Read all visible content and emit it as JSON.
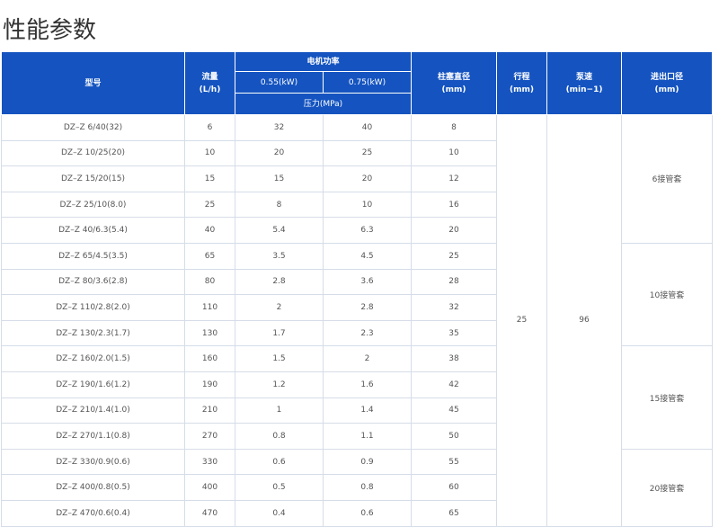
{
  "title": "性能参数",
  "header": {
    "model": "型号",
    "flow": "流量",
    "flow_unit": "(L/h)",
    "motor_power": "电机功率",
    "power_a": "0.55(kW)",
    "power_b": "0.75(kW)",
    "pressure": "压力(MPa)",
    "plunger": "柱塞直径",
    "plunger_unit": "(mm)",
    "stroke": "行程",
    "stroke_unit": "(mm)",
    "pump_speed": "泵速",
    "pump_speed_unit": "(min−1)",
    "port": "进出口径",
    "port_unit": "(mm)"
  },
  "rows": [
    {
      "model": "DZ–Z 6/40(32)",
      "flow": "6",
      "p1": "32",
      "p2": "40",
      "plunger": "8"
    },
    {
      "model": "DZ–Z 10/25(20)",
      "flow": "10",
      "p1": "20",
      "p2": "25",
      "plunger": "10"
    },
    {
      "model": "DZ–Z 15/20(15)",
      "flow": "15",
      "p1": "15",
      "p2": "20",
      "plunger": "12"
    },
    {
      "model": "DZ–Z 25/10(8.0)",
      "flow": "25",
      "p1": "8",
      "p2": "10",
      "plunger": "16"
    },
    {
      "model": "DZ–Z 40/6.3(5.4)",
      "flow": "40",
      "p1": "5.4",
      "p2": "6.3",
      "plunger": "20"
    },
    {
      "model": "DZ–Z 65/4.5(3.5)",
      "flow": "65",
      "p1": "3.5",
      "p2": "4.5",
      "plunger": "25"
    },
    {
      "model": "DZ–Z 80/3.6(2.8)",
      "flow": "80",
      "p1": "2.8",
      "p2": "3.6",
      "plunger": "28"
    },
    {
      "model": "DZ–Z 110/2.8(2.0)",
      "flow": "110",
      "p1": "2",
      "p2": "2.8",
      "plunger": "32"
    },
    {
      "model": "DZ–Z 130/2.3(1.7)",
      "flow": "130",
      "p1": "1.7",
      "p2": "2.3",
      "plunger": "35"
    },
    {
      "model": "DZ–Z 160/2.0(1.5)",
      "flow": "160",
      "p1": "1.5",
      "p2": "2",
      "plunger": "38"
    },
    {
      "model": "DZ–Z 190/1.6(1.2)",
      "flow": "190",
      "p1": "1.2",
      "p2": "1.6",
      "plunger": "42"
    },
    {
      "model": "DZ–Z 210/1.4(1.0)",
      "flow": "210",
      "p1": "1",
      "p2": "1.4",
      "plunger": "45"
    },
    {
      "model": "DZ–Z 270/1.1(0.8)",
      "flow": "270",
      "p1": "0.8",
      "p2": "1.1",
      "plunger": "50"
    },
    {
      "model": "DZ–Z 330/0.9(0.6)",
      "flow": "330",
      "p1": "0.6",
      "p2": "0.9",
      "plunger": "55"
    },
    {
      "model": "DZ–Z 400/0.8(0.5)",
      "flow": "400",
      "p1": "0.5",
      "p2": "0.8",
      "plunger": "60"
    },
    {
      "model": "DZ–Z 470/0.6(0.4)",
      "flow": "470",
      "p1": "0.4",
      "p2": "0.6",
      "plunger": "65"
    }
  ],
  "stroke_value": "25",
  "speed_value": "96",
  "port_groups": [
    {
      "label": "6接管套",
      "span": 5
    },
    {
      "label": "10接管套",
      "span": 4
    },
    {
      "label": "15接管套",
      "span": 4
    },
    {
      "label": "20接管套",
      "span": 3
    }
  ],
  "colors": {
    "header_bg": "#1554c0",
    "header_text": "#ffffff",
    "border": "#d6dde8",
    "cell_text": "#555555"
  }
}
